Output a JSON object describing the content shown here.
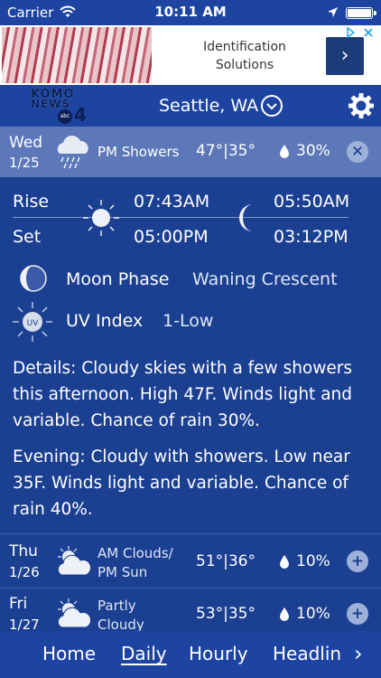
{
  "status_bar": {
    "carrier": "Carrier",
    "time": "10:11 AM"
  },
  "ad": {
    "line1": "Identification",
    "line2": "Solutions"
  },
  "header": {
    "logo_top": "KOMO",
    "logo_mid": "NEWS",
    "logo_badge": "abc",
    "logo_num": "4",
    "city": "Seattle, WA"
  },
  "today": {
    "day": "Wed",
    "date": "1/25",
    "condition": "PM Showers",
    "temps": "47°|35°",
    "precip": "30%"
  },
  "astro": {
    "rise_label": "Rise",
    "set_label": "Set",
    "sunrise": "07:43AM",
    "sunset": "05:00PM",
    "moonrise": "05:50AM",
    "moonset": "03:12PM"
  },
  "moon_phase": {
    "label": "Moon Phase",
    "value": "Waning Crescent"
  },
  "uv": {
    "label": "UV Index",
    "value": "1-Low",
    "icon_text": "UV"
  },
  "details": "Details: Cloudy skies with a few showers this afternoon. High 47F. Winds light and variable. Chance of rain 30%.",
  "evening": "Evening: Cloudy with showers. Low near 35F. Winds light and variable. Chance of rain 40%.",
  "forecast": [
    {
      "day": "Thu",
      "date": "1/26",
      "cond1": "AM Clouds/",
      "cond2": "PM Sun",
      "temps": "51°|36°",
      "precip": "10%"
    },
    {
      "day": "Fri",
      "date": "1/27",
      "cond1": "Partly",
      "cond2": "Cloudy",
      "temps": "53°|35°",
      "precip": "10%"
    }
  ],
  "nav": {
    "home": "Home",
    "daily": "Daily",
    "hourly": "Hourly",
    "headlines": "Headlin"
  },
  "icons": {
    "wifi": "wifi-icon",
    "location": "location-arrow-icon",
    "battery": "battery-icon",
    "gear": "gear-icon",
    "chevron": "chevron-down-icon",
    "rain": "rain-cloud-icon",
    "sun": "sun-icon",
    "moon": "crescent-moon-icon",
    "partly": "partly-cloudy-icon",
    "close": "close-icon",
    "expand": "plus-icon",
    "drop": "raindrop-icon",
    "next": "chevron-right-icon"
  },
  "colors": {
    "background": "#1b3f91",
    "header": "#1d44a0",
    "today_row": "#5c78b8",
    "button": "#9db0d8"
  }
}
